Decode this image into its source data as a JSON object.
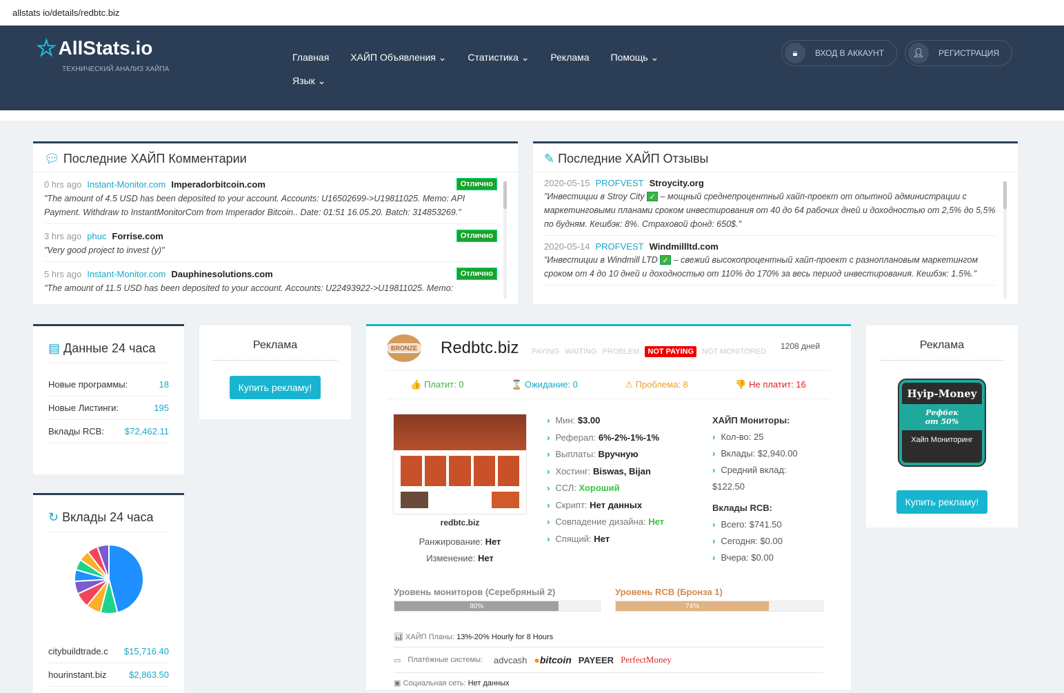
{
  "url": "allstats io/details/redbtc.biz",
  "header": {
    "logo": "AllStats.io",
    "tagline": "ТЕХНИЧЕСКИЙ АНАЛИЗ ХАЙПА",
    "nav": [
      "Главная",
      "ХАЙП Объявления",
      "Статистика",
      "Реклама",
      "Помощь"
    ],
    "lang": "Язык",
    "login": "ВХОД В АККАУНТ",
    "register": "РЕГИСТРАЦИЯ"
  },
  "comments": {
    "title": "Последние ХАЙП Комментарии",
    "items": [
      {
        "ago": "0 hrs ago",
        "user": "Instant-Monitor.com",
        "site": "Imperadorbitcoin.com",
        "badge": "Отлично",
        "text": "\"The amount of 4.5 USD has been deposited to your account. Accounts: U16502699->U19811025. Memo: API Payment. Withdraw to InstantMonitorCom from Imperador Bitcoin.. Date: 01:51 16.05.20. Batch: 314853269.\""
      },
      {
        "ago": "3 hrs ago",
        "user": "phuc",
        "site": "Forrise.com",
        "badge": "Отлично",
        "text": "\"Very good project to invest (y)\""
      },
      {
        "ago": "5 hrs ago",
        "user": "Instant-Monitor.com",
        "site": "Dauphinesolutions.com",
        "badge": "Отлично",
        "text": "\"The amount of 11.5 USD has been deposited to your account. Accounts: U22493922->U19811025. Memo:"
      }
    ]
  },
  "reviews": {
    "title": "Последние ХАЙП Отзывы",
    "items": [
      {
        "date": "2020-05-15",
        "user": "PROFVEST",
        "site": "Stroycity.org",
        "pre": "\"Инвестиции в Stroy City",
        "text": "– мощный среднепроцентный хайп-проект от опытной администрации с маркетинговыми планами сроком инвестирования от 40 до 64 рабочих дней и доходностью от 2,5% до 5,5% по будням. Кешбэк: 8%. Страховой фонд: 650$.\""
      },
      {
        "date": "2020-05-14",
        "user": "PROFVEST",
        "site": "Windmillltd.com",
        "pre": "\"Инвестиции в Windmill LTD",
        "text": "– свежий высокопроцентный хайп-проект с разноплановым маркетингом сроком от 4 до 10 дней и доходностью от 110% до 170% за весь период инвестирования. Кешбэк: 1.5%.\""
      }
    ]
  },
  "data24": {
    "title": "Данные 24 часа",
    "rows": [
      {
        "k": "Новые программы:",
        "v": "18"
      },
      {
        "k": "Новые Листинги:",
        "v": "195"
      },
      {
        "k": "Вклады RCB:",
        "v": "$72,462.11"
      }
    ]
  },
  "ad": {
    "title": "Реклама",
    "button": "Купить рекламу!"
  },
  "ad2": {
    "title": "Реклама",
    "button": "Купить рекламу!",
    "banner": {
      "top": "Hyip-Money",
      "mid1": "Рефбек",
      "mid2": "от 50%",
      "bottom": "Хайп Мониторинг"
    }
  },
  "deposits24": {
    "title": "Вклады 24 часа",
    "rows": [
      {
        "k": "citybuildtrade.c",
        "v": "$15,716.40"
      },
      {
        "k": "hourinstant.biz",
        "v": "$2,863.50"
      }
    ],
    "pie": [
      46,
      8,
      7,
      7,
      6,
      5.5,
      5,
      5,
      5,
      5.5
    ],
    "colors": [
      "#1e90ff",
      "#1dd38f",
      "#fbb02b",
      "#f5455c",
      "#7a5ccf",
      "#1e90ff",
      "#1dd38f",
      "#fbb02b",
      "#f5455c",
      "#7a5ccf"
    ]
  },
  "project": {
    "level": "BRONZE",
    "name": "Redbtc.biz",
    "statuses": [
      "PAYING",
      "WAITING",
      "PROBLEM",
      "NOT PAYING",
      "NOT MONITORED"
    ],
    "active_status": 3,
    "days": "1208 дней",
    "votes": [
      {
        "l": "Платит: 0",
        "c": "#3bb53b",
        "i": "👍"
      },
      {
        "l": "Ожидание: 0",
        "c": "#17a9c9",
        "i": "⌛"
      },
      {
        "l": "Проблема: 8",
        "c": "#f0a020",
        "i": "⚠"
      },
      {
        "l": "Не платит: 16",
        "c": "#e02020",
        "i": "👎"
      }
    ],
    "domain": "redbtc.biz",
    "rank_label": "Ранжирование:",
    "rank": "Нет",
    "change_label": "Изменение:",
    "change": "Нет",
    "details": [
      {
        "k": "Мин:",
        "v": "$3.00"
      },
      {
        "k": "Реферал:",
        "v": "6%-2%-1%-1%"
      },
      {
        "k": "Выплаты:",
        "v": "Вручную"
      },
      {
        "k": "Хостинг:",
        "v": "Biswas, Bijan"
      },
      {
        "k": "ССЛ:",
        "v": "Хороший",
        "g": true
      },
      {
        "k": "Скрипт:",
        "v": "Нет данных"
      },
      {
        "k": "Совпадение дизайна:",
        "v": "Нет",
        "g": true
      },
      {
        "k": "Спящий:",
        "v": "Нет"
      }
    ],
    "monitors_title": "ХАЙП Мониторы:",
    "monitors": [
      "Кол-во: 25",
      "Вклады: $2,940.00",
      "Средний вклад:"
    ],
    "avg": "$122.50",
    "rcb_title": "Вклады RCB:",
    "rcb": [
      "Всего: $741.50",
      "Сегодня: $0.00",
      "Вчера: $0.00"
    ],
    "mon_level": "Уровень мониторов (Серебряный 2)",
    "mon_pct": 80,
    "mon_pct_label": "80%",
    "rcb_level": "Уровень RCB (Бронза 1)",
    "rcb_pct": 74,
    "rcb_pct_label": "74%",
    "plans_label": "ХАЙП Планы:",
    "plans": "13%-20% Hourly for 8 Hours",
    "pay_label": "Платёжные системы:",
    "pay": [
      "advcash",
      "bitcoin",
      "PAYEER",
      "PerfectMoney"
    ],
    "social_label": "Социальная сеть:",
    "social": "Нет данных"
  }
}
